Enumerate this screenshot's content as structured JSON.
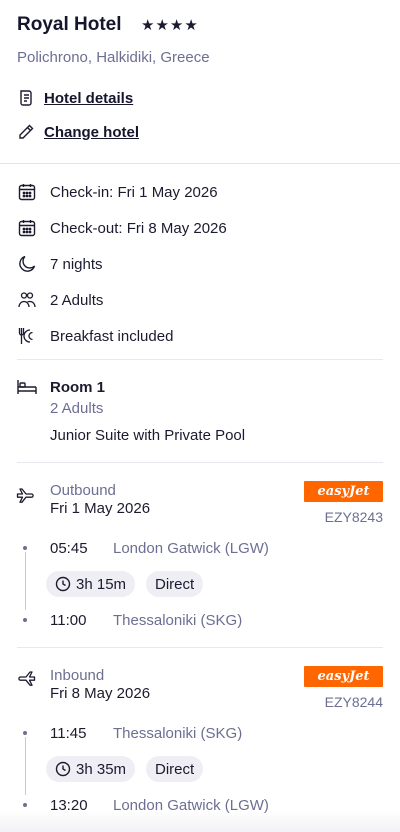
{
  "hotel": {
    "name": "Royal Hotel",
    "stars": "★★★★",
    "star_rating": 4,
    "location": "Polichrono, Halkidiki, Greece",
    "details_link": "Hotel details",
    "change_link": "Change hotel"
  },
  "stay": {
    "check_in": "Check-in: Fri 1 May 2026",
    "check_out": "Check-out: Fri 8 May 2026",
    "nights": "7 nights",
    "guests": "2 Adults",
    "board": "Breakfast included"
  },
  "room": {
    "title": "Room 1",
    "occupancy": "2 Adults",
    "type": "Junior Suite with Private Pool"
  },
  "outbound": {
    "label": "Outbound",
    "date": "Fri 1 May 2026",
    "airline": "easyJet",
    "flight_number": "EZY8243",
    "depart_time": "05:45",
    "depart_airport": "London Gatwick (LGW)",
    "duration": "3h 15m",
    "stops": "Direct",
    "arrive_time": "11:00",
    "arrive_airport": "Thessaloniki (SKG)"
  },
  "inbound": {
    "label": "Inbound",
    "date": "Fri 8 May 2026",
    "airline": "easyJet",
    "flight_number": "EZY8244",
    "depart_time": "11:45",
    "depart_airport": "Thessaloniki (SKG)",
    "duration": "3h 35m",
    "stops": "Direct",
    "arrive_time": "13:20",
    "arrive_airport": "London Gatwick (LGW)"
  },
  "colors": {
    "airline_brand": "#ff6600",
    "muted_text": "#6c6f93",
    "pill_bg": "#eeeef4"
  }
}
